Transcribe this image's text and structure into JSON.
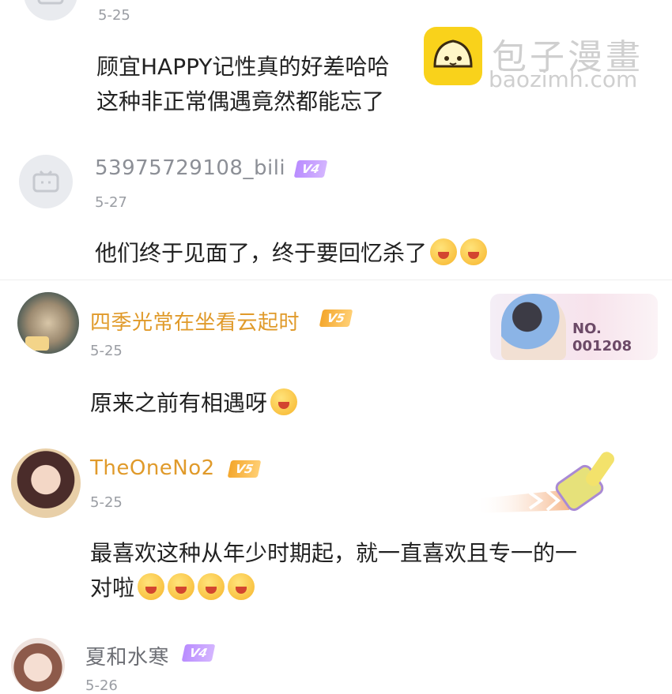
{
  "watermark": {
    "brand": "包子漫畫",
    "domain": "baozimh.com"
  },
  "comments": [
    {
      "date": "5-25",
      "lines": [
        "顾宜HAPPY记性真的好差哈哈",
        "这种非正常偶遇竟然都能忘了"
      ]
    },
    {
      "user": "53975729108_bili",
      "level": "V4",
      "date": "5-27",
      "text": "他们终于见面了，终于要回忆杀了"
    },
    {
      "user": "四季光常在坐看云起时",
      "level": "V5",
      "date": "5-25",
      "text": "原来之前有相遇呀",
      "card_number": "NO.\n001208"
    },
    {
      "user": "TheOneNo2",
      "level": "V5",
      "date": "5-25",
      "lines": [
        "最喜欢这种从年少时期起，就一直喜欢且专一的一",
        "对啦"
      ]
    },
    {
      "user": "夏和水寒",
      "level": "V4",
      "date": "5-26"
    }
  ],
  "colors": {
    "name_gray": "#8c8f96",
    "name_gold": "#e09a2a",
    "v4": "#b98cff",
    "v5": "#f4a72d"
  }
}
